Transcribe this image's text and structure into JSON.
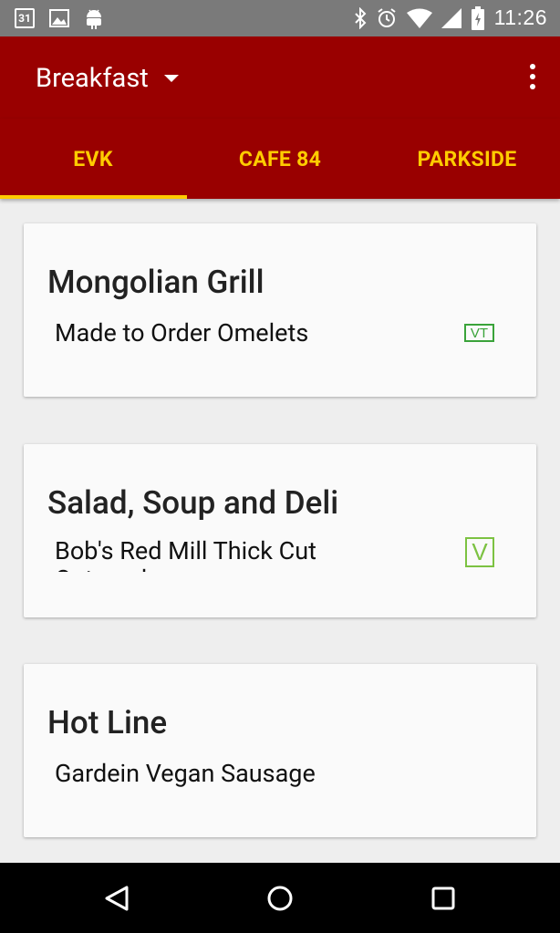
{
  "status_bar": {
    "time": "11:26",
    "calendar_day": "31",
    "left_icons": [
      "calendar-icon",
      "image-icon",
      "android-icon"
    ],
    "right_icons": [
      "bluetooth-icon",
      "alarm-icon",
      "wifi-icon",
      "signal-icon",
      "battery-icon"
    ]
  },
  "app_bar": {
    "title": "Breakfast",
    "menu_icon": "overflow-menu-icon"
  },
  "tabs": [
    {
      "label": "EVK",
      "selected": true
    },
    {
      "label": "CAFE 84",
      "selected": false
    },
    {
      "label": "PARKSIDE",
      "selected": false
    }
  ],
  "stations": [
    {
      "title": "Mongolian Grill",
      "item": "Made to Order Omelets",
      "badge": "VT"
    },
    {
      "title": "Salad, Soup and Deli",
      "item": "Bob's Red Mill Thick Cut Oatmeal",
      "badge": "V"
    },
    {
      "title": "Hot Line",
      "item": "Gardein Vegan Sausage",
      "badge": ""
    }
  ],
  "colors": {
    "primary": "#990000",
    "accent": "#ffcc00",
    "badge_vt": "#3aa33a",
    "badge_v": "#7cc242"
  },
  "nav_bar": [
    "back-icon",
    "home-icon",
    "recents-icon"
  ]
}
